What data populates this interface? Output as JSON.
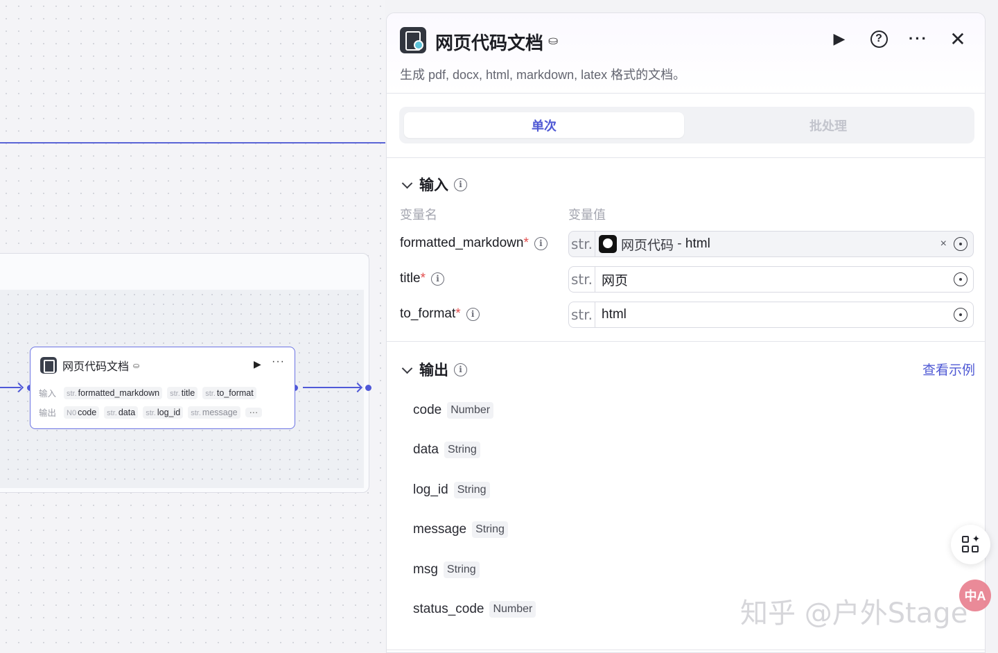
{
  "node": {
    "title": "网页代码文档",
    "input_label": "输入",
    "output_label": "输出",
    "inputs": [
      {
        "type": "str.",
        "name": "formatted_markdown"
      },
      {
        "type": "str.",
        "name": "title"
      },
      {
        "type": "str.",
        "name": "to_format"
      }
    ],
    "outputs": [
      {
        "type": "N0",
        "name": "code"
      },
      {
        "type": "str.",
        "name": "data"
      },
      {
        "type": "str.",
        "name": "log_id"
      },
      {
        "type": "str.",
        "name": "message"
      }
    ],
    "more_label": "···"
  },
  "panel": {
    "title": "网页代码文档",
    "description": "生成 pdf, docx, html, markdown, latex 格式的文档。",
    "mode_tabs": [
      "单次",
      "批处理"
    ],
    "active_tab": "单次",
    "input_section": {
      "title": "输入",
      "col_name": "变量名",
      "col_value": "变量值",
      "rows": [
        {
          "name": "formatted_markdown",
          "required_mark": "*",
          "type": "str.",
          "ref_node": "网页代码",
          "ref_sep": " - ",
          "ref_field": "html",
          "clear": "×"
        },
        {
          "name": "title",
          "required_mark": "*",
          "type": "str.",
          "value": "网页"
        },
        {
          "name": "to_format",
          "required_mark": "*",
          "type": "str.",
          "value": "html"
        }
      ]
    },
    "output_section": {
      "title": "输出",
      "view_example": "查看示例",
      "rows": [
        {
          "name": "code",
          "type": "Number"
        },
        {
          "name": "data",
          "type": "String"
        },
        {
          "name": "log_id",
          "type": "String"
        },
        {
          "name": "message",
          "type": "String"
        },
        {
          "name": "msg",
          "type": "String"
        },
        {
          "name": "status_code",
          "type": "Number"
        }
      ]
    }
  },
  "icons": {
    "run": "play-icon",
    "help": "help-circle-icon",
    "more": "more-horizontal-icon",
    "close": "close-icon",
    "info": "info-icon",
    "variable": "variable-icon"
  },
  "accent_color": "#4e58d4",
  "required_color": "#e24c4c",
  "floating": {
    "translate_label": "中A"
  },
  "watermark": "知乎 @户外Stage"
}
